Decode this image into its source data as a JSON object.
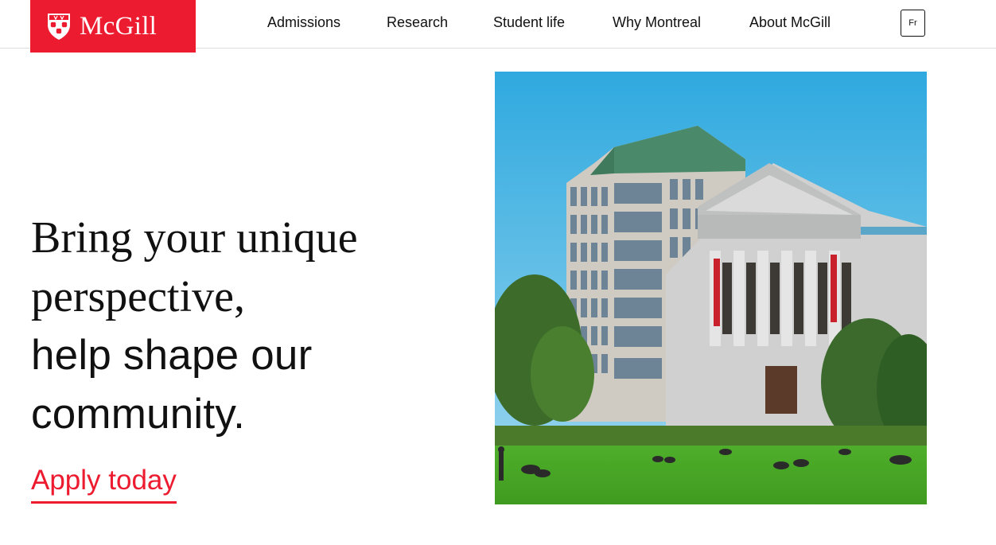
{
  "header": {
    "logo_text": "McGill",
    "nav": [
      "Admissions",
      "Research",
      "Student life",
      "Why Montreal",
      "About McGill"
    ],
    "lang_label": "Fr"
  },
  "hero": {
    "line1": "Bring your unique",
    "line2": "perspective,",
    "line3": "help shape our",
    "line4": "community.",
    "cta": "Apply today"
  },
  "colors": {
    "brand_red": "#ed1b2f"
  },
  "icons": {
    "logo_shield": "mcgill-shield-icon"
  }
}
